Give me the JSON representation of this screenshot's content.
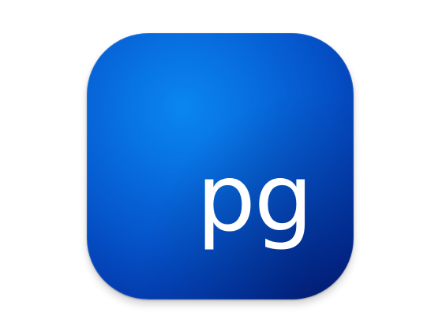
{
  "icon": {
    "label": "pg",
    "colors": {
      "background_light": "#0a86f0",
      "background_mid": "#0553c9",
      "background_dark": "#03238a",
      "text": "#ffffff"
    }
  }
}
